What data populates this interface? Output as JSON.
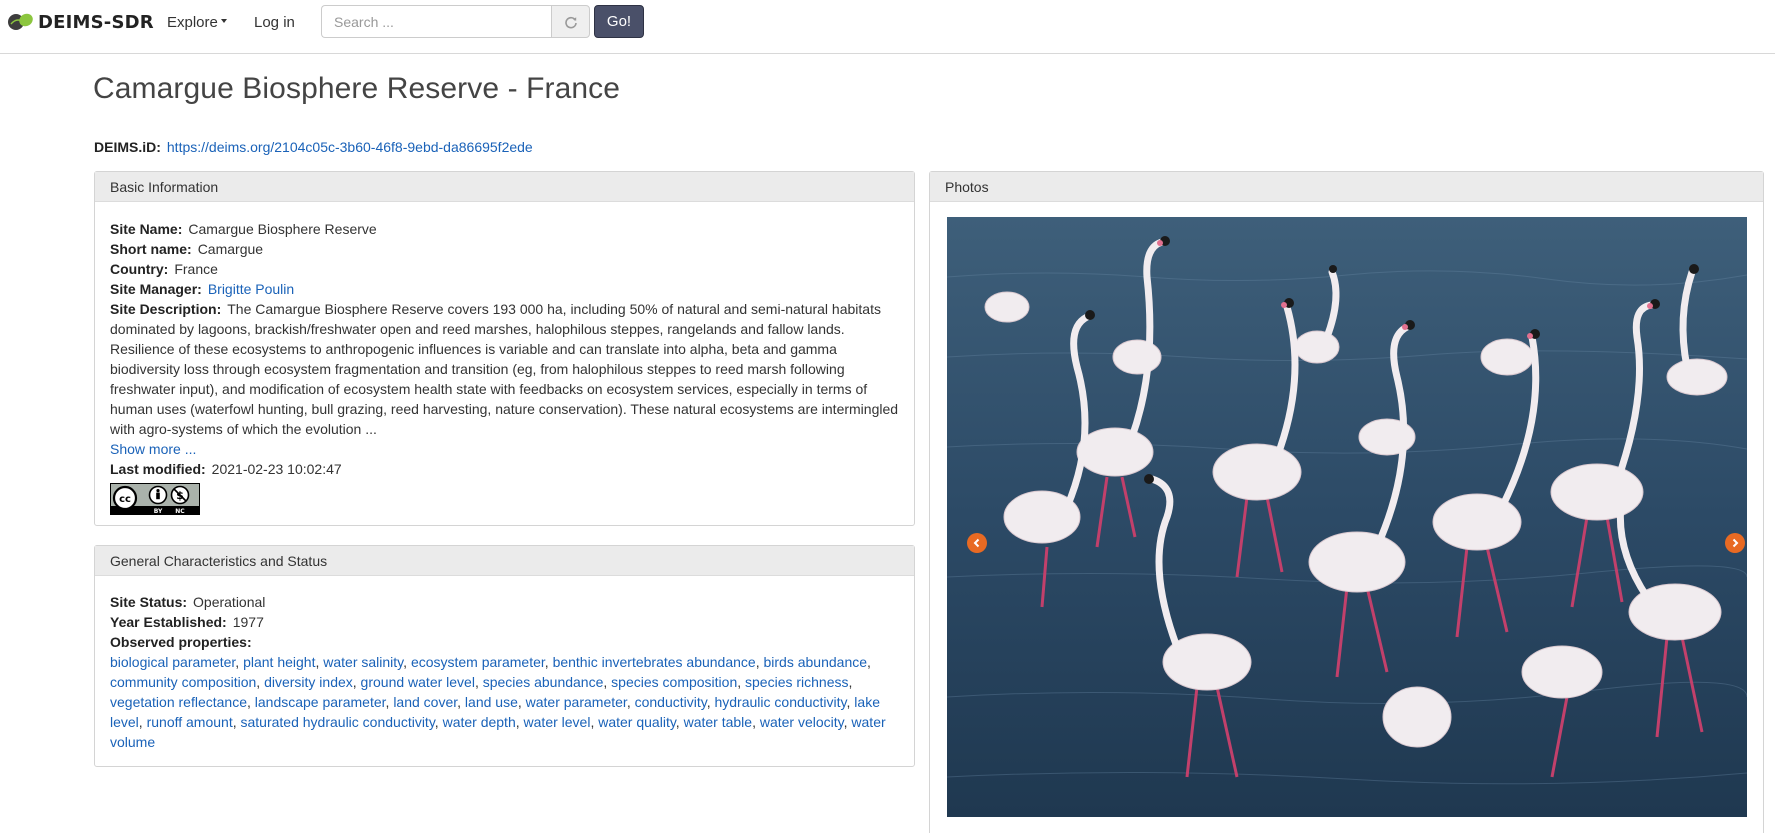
{
  "nav": {
    "brand": "DEIMS-SDR",
    "explore": "Explore",
    "login": "Log in",
    "search_placeholder": "Search ...",
    "go": "Go!"
  },
  "page": {
    "title": "Camargue Biosphere Reserve - France",
    "deims_id_label": "DEIMS.iD:",
    "deims_id_url": "https://deims.org/2104c05c-3b60-46f8-9ebd-da86695f2ede"
  },
  "basic": {
    "heading": "Basic Information",
    "site_name_label": "Site Name:",
    "site_name": "Camargue Biosphere Reserve",
    "short_name_label": "Short name:",
    "short_name": "Camargue",
    "country_label": "Country:",
    "country": "France",
    "manager_label": "Site Manager:",
    "manager": "Brigitte Poulin",
    "description_label": "Site Description:",
    "description": "The Camargue Biosphere Reserve covers 193 000 ha, including 50% of natural and semi-natural habitats dominated by lagoons, brackish/freshwater open and reed marshes, halophilous steppes, rangelands and fallow lands. Resilience of these ecosystems to anthropogenic influences is variable and can translate into alpha, beta and gamma biodiversity loss through ecosystem fragmentation and transition (eg, from halophilous steppes to reed marsh following freshwater input), and modification of ecosystem health state with feedbacks on ecosystem services, especially in terms of human uses (waterfowl hunting, bull grazing, reed harvesting, nature conservation). These natural ecosystems are intermingled with agro-systems of which the evolution ...",
    "show_more": "Show more ...",
    "modified_label": "Last modified:",
    "modified": "2021-02-23 10:02:47",
    "license_by": "BY",
    "license_nc": "NC"
  },
  "general": {
    "heading": "General Characteristics and Status",
    "status_label": "Site Status:",
    "status": "Operational",
    "year_label": "Year Established:",
    "year": "1977",
    "observed_label": "Observed properties:",
    "observed": [
      "biological parameter",
      "plant height",
      "water salinity",
      "ecosystem parameter",
      "benthic invertebrates abundance",
      "birds abundance",
      "community composition",
      "diversity index",
      "ground water level",
      "species abundance",
      "species composition",
      "species richness",
      "vegetation reflectance",
      "landscape parameter",
      "land cover",
      "land use",
      "water parameter",
      "conductivity",
      "hydraulic conductivity",
      "lake level",
      "runoff amount",
      "saturated hydraulic conductivity",
      "water depth",
      "water level",
      "water quality",
      "water table",
      "water velocity",
      "water volume"
    ]
  },
  "photos": {
    "heading": "Photos"
  },
  "colors": {
    "link": "#1a62b8",
    "go_button": "#4a5069",
    "carousel_arrow": "#e86a23",
    "water": "#2d4a63"
  }
}
